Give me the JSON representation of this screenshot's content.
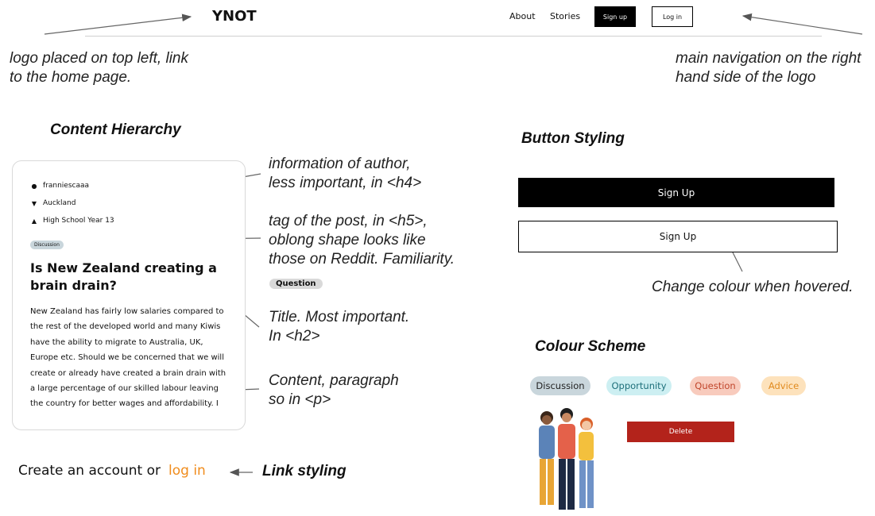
{
  "navbar": {
    "logo": "YNOT",
    "links": [
      "About",
      "Stories"
    ],
    "signup_label": "Sign up",
    "login_label": "Log in"
  },
  "annotations": {
    "logo_note": [
      "logo placed on top left, link",
      "to the home page."
    ],
    "nav_note": [
      "main navigation on the right",
      "hand side of the logo"
    ],
    "author_note": [
      "information of author,",
      "less important, in <h4>"
    ],
    "tag_note": [
      "tag of the post, in <h5>,",
      "oblong shape looks like",
      "those on Reddit. Familiarity."
    ],
    "title_note": [
      "Title. Most important.",
      "In <h2>"
    ],
    "content_note": [
      "Content, paragraph",
      "so in <p>"
    ],
    "hover_note": "Change colour when hovered.",
    "link_note": "Link styling"
  },
  "headings": {
    "content_hierarchy": "Content Hierarchy",
    "button_styling": "Button Styling",
    "colour_scheme": "Colour Scheme"
  },
  "card": {
    "author": "franniescaaa",
    "location": "Auckland",
    "school": "High School Year 13",
    "tag": "Discussion",
    "title": "Is New Zealand creating a brain drain?",
    "body": "New Zealand has fairly low salaries compared to the rest of the developed world and many Kiwis have the ability to migrate to Australia, UK, Europe etc. Should we be concerned that we will create or already have created a brain drain with a large percentage of our skilled labour leaving the country for better wages and affordability. I"
  },
  "question_tag": "Question",
  "buttons": {
    "signup_filled": "Sign Up",
    "signup_outline": "Sign Up",
    "delete": "Delete"
  },
  "colour_scheme": [
    {
      "label": "Discussion",
      "bg": "#c9d6dc",
      "fg": "#222222"
    },
    {
      "label": "Opportunity",
      "bg": "#cdeff2",
      "fg": "#1d6f7a"
    },
    {
      "label": "Question",
      "bg": "#f8cbbd",
      "fg": "#c0442a"
    },
    {
      "label": "Advice",
      "bg": "#fde2bc",
      "fg": "#e08a1f"
    }
  ],
  "link_line": {
    "text": "Create an account or",
    "link": "log in"
  },
  "colors": {
    "accent_orange": "#f08c1c",
    "delete_red": "#b3231b"
  }
}
